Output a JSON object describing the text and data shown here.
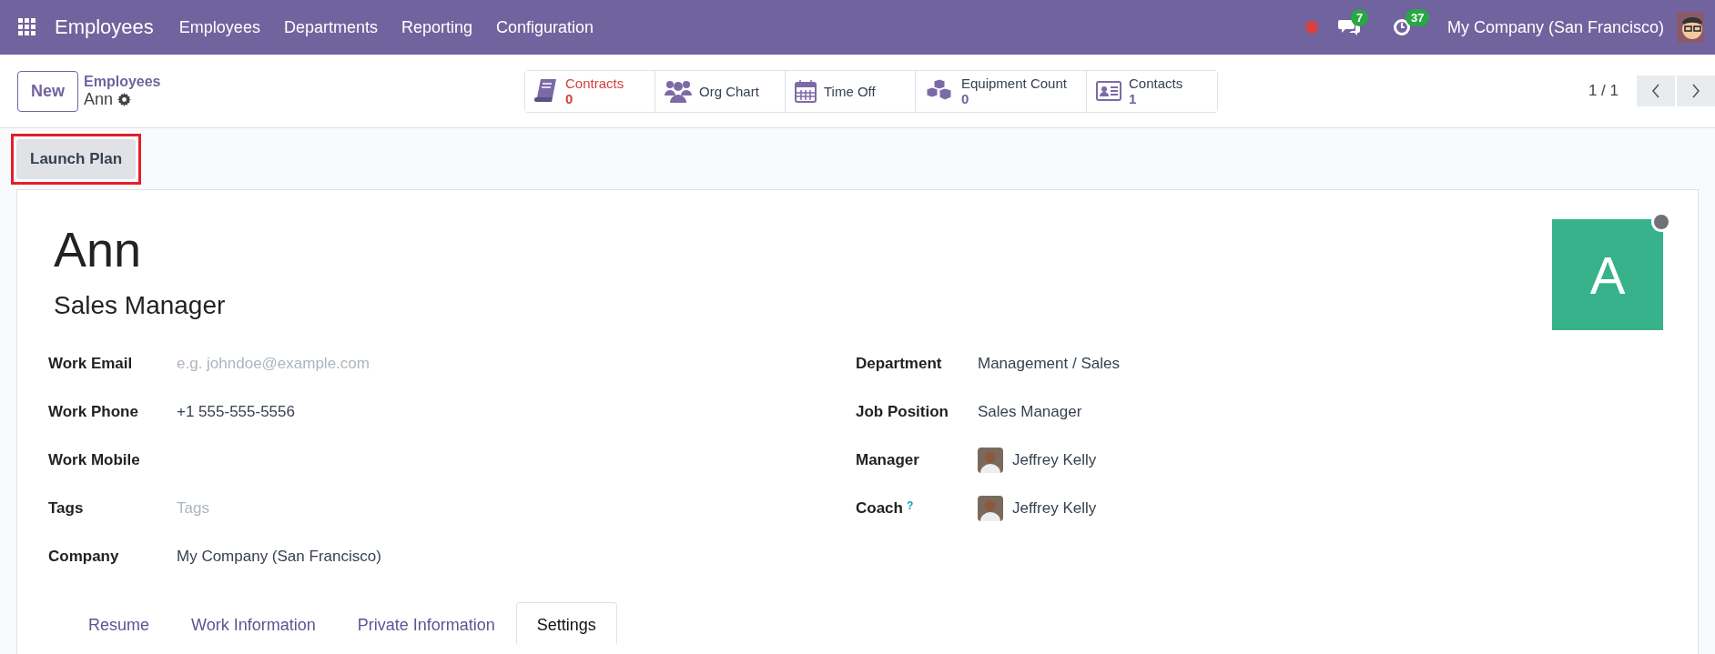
{
  "navbar": {
    "app": "Employees",
    "menu": [
      "Employees",
      "Departments",
      "Reporting",
      "Configuration"
    ],
    "messages_count": "7",
    "activities_count": "37",
    "company": "My Company (San Francisco)"
  },
  "control_panel": {
    "new_button": "New",
    "breadcrumb": "Employees",
    "record": "Ann",
    "pager": "1 / 1"
  },
  "smart_buttons": [
    {
      "kind": "book",
      "label": "Contracts",
      "value": "0",
      "warning": true
    },
    {
      "kind": "people",
      "label": "Org Chart",
      "warning": false
    },
    {
      "kind": "calendar",
      "label": "Time Off",
      "warning": false
    },
    {
      "kind": "boxes",
      "label": "Equipment Count",
      "value": "0",
      "warning": false
    },
    {
      "kind": "card",
      "label": "Contacts",
      "value": "1",
      "warning": false
    }
  ],
  "action_button": {
    "label": "Launch Plan",
    "highlighted": true
  },
  "employee": {
    "name": "Ann",
    "job_title": "Sales Manager",
    "avatar_letter": "A"
  },
  "left_fields": [
    {
      "label": "Work Email",
      "placeholder": "e.g. johndoe@example.com"
    },
    {
      "label": "Work Phone",
      "value": "+1 555-555-5556"
    },
    {
      "label": "Work Mobile"
    },
    {
      "label": "Tags",
      "placeholder": "Tags"
    },
    {
      "label": "Company",
      "value": "My Company (San Francisco)"
    }
  ],
  "right_fields": [
    {
      "label": "Department",
      "value": "Management / Sales",
      "kind": "text"
    },
    {
      "label": "Job Position",
      "value": "Sales Manager",
      "kind": "text"
    },
    {
      "label": "Manager",
      "value": "Jeffrey Kelly",
      "kind": "person"
    },
    {
      "label": "Coach",
      "help": "?",
      "value": "Jeffrey Kelly",
      "kind": "person"
    }
  ],
  "tabs": [
    {
      "label": "Resume",
      "selected": false
    },
    {
      "label": "Work Information",
      "selected": false
    },
    {
      "label": "Private Information",
      "selected": false
    },
    {
      "label": "Settings",
      "selected": true
    }
  ]
}
